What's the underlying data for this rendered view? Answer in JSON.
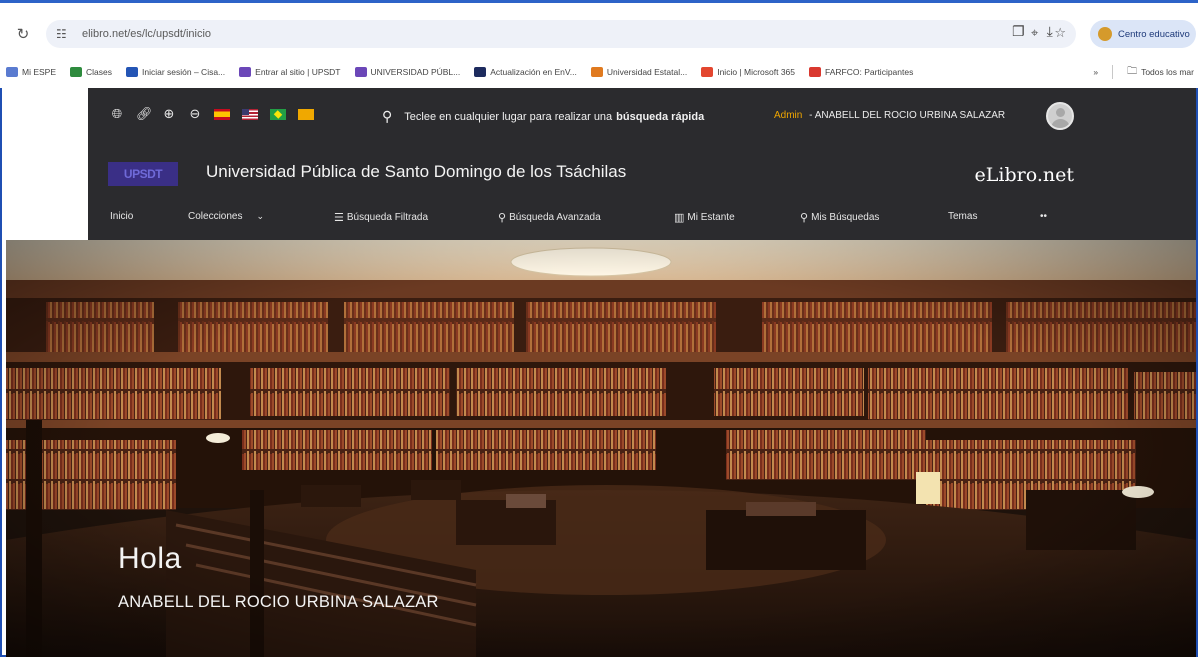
{
  "browser": {
    "url": "elibro.net/es/lc/upsdt/inicio",
    "profile_name": "Centro educativo",
    "bookmarks": [
      {
        "label": "Mi ESPE",
        "color": "#5a7bd0"
      },
      {
        "label": "Clases",
        "color": "#2e8b3e"
      },
      {
        "label": "Iniciar sesión – Cisa...",
        "color": "#2455b5"
      },
      {
        "label": "Entrar al sitio | UPSDT",
        "color": "#6b47b8"
      },
      {
        "label": "UNIVERSIDAD PÚBL...",
        "color": "#6b47b8"
      },
      {
        "label": "Actualización en EnV...",
        "color": "#1d2b5e"
      },
      {
        "label": "Universidad Estatal...",
        "color": "#e07a1f"
      },
      {
        "label": "Inicio | Microsoft 365",
        "color": "#e3462f"
      },
      {
        "label": "FARFCO: Participantes",
        "color": "#d9382f"
      }
    ],
    "bookmarks_overflow": "»",
    "all_bookmarks": "Todos los mar"
  },
  "site": {
    "search_prompt": "Teclee en cualquier lugar para realizar una",
    "search_prompt_bold": "búsqueda rápida",
    "role": "Admin",
    "user_header": "- ANABELL DEL ROCIO URBINA SALAZAR",
    "logo_text": "UPSDT",
    "university_name": "Universidad Pública de Santo Domingo de los Tsáchilas",
    "brand": "eLibro.net",
    "nav": {
      "inicio": "Inicio",
      "colecciones": "Colecciones",
      "filtrada": "Búsqueda Filtrada",
      "avanzada": "Búsqueda Avanzada",
      "estante": "Mi Estante",
      "busquedas": "Mis Búsquedas",
      "temas": "Temas",
      "more": "••"
    }
  },
  "hero": {
    "greeting": "Hola",
    "user_name": "ANABELL DEL ROCIO URBINA SALAZAR"
  },
  "colors": {
    "header_bg": "#2b2b2e",
    "accent_admin": "#f0a600"
  }
}
